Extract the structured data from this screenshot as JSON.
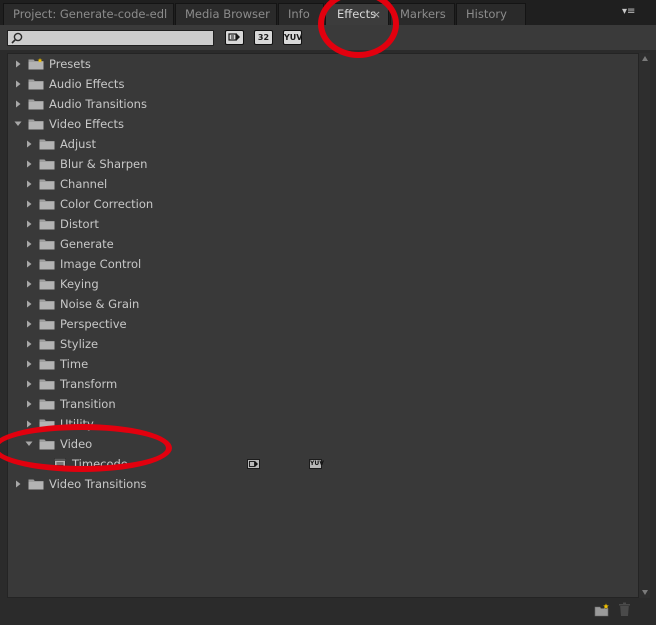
{
  "tabs": [
    {
      "label": "Project: Generate-code-edl",
      "active": false
    },
    {
      "label": "Media Browser",
      "active": false
    },
    {
      "label": "Info",
      "active": false
    },
    {
      "label": "Effects",
      "active": true,
      "close": "×"
    },
    {
      "label": "Markers",
      "active": false
    },
    {
      "label": "History",
      "active": false
    }
  ],
  "panel_menu_glyph": "▾≡",
  "search": {
    "value": "",
    "placeholder": ""
  },
  "toolbar": {
    "accelerated_label": "",
    "bit32_label": "32",
    "yuv_label": "YUV"
  },
  "tree": [
    {
      "label": "Presets",
      "level": 0,
      "expanded": false,
      "icon": "preset-folder-icon"
    },
    {
      "label": "Audio Effects",
      "level": 0,
      "expanded": false,
      "icon": "folder-icon"
    },
    {
      "label": "Audio Transitions",
      "level": 0,
      "expanded": false,
      "icon": "folder-icon"
    },
    {
      "label": "Video Effects",
      "level": 0,
      "expanded": true,
      "icon": "folder-icon"
    },
    {
      "label": "Adjust",
      "level": 1,
      "expanded": false,
      "icon": "folder-icon"
    },
    {
      "label": "Blur & Sharpen",
      "level": 1,
      "expanded": false,
      "icon": "folder-icon"
    },
    {
      "label": "Channel",
      "level": 1,
      "expanded": false,
      "icon": "folder-icon"
    },
    {
      "label": "Color Correction",
      "level": 1,
      "expanded": false,
      "icon": "folder-icon"
    },
    {
      "label": "Distort",
      "level": 1,
      "expanded": false,
      "icon": "folder-icon"
    },
    {
      "label": "Generate",
      "level": 1,
      "expanded": false,
      "icon": "folder-icon"
    },
    {
      "label": "Image Control",
      "level": 1,
      "expanded": false,
      "icon": "folder-icon"
    },
    {
      "label": "Keying",
      "level": 1,
      "expanded": false,
      "icon": "folder-icon"
    },
    {
      "label": "Noise & Grain",
      "level": 1,
      "expanded": false,
      "icon": "folder-icon"
    },
    {
      "label": "Perspective",
      "level": 1,
      "expanded": false,
      "icon": "folder-icon"
    },
    {
      "label": "Stylize",
      "level": 1,
      "expanded": false,
      "icon": "folder-icon"
    },
    {
      "label": "Time",
      "level": 1,
      "expanded": false,
      "icon": "folder-icon"
    },
    {
      "label": "Transform",
      "level": 1,
      "expanded": false,
      "icon": "folder-icon"
    },
    {
      "label": "Transition",
      "level": 1,
      "expanded": false,
      "icon": "folder-icon"
    },
    {
      "label": "Utility",
      "level": 1,
      "expanded": false,
      "icon": "folder-icon"
    },
    {
      "label": "Video",
      "level": 1,
      "expanded": true,
      "icon": "folder-icon"
    },
    {
      "label": "Timecode",
      "level": 2,
      "effect": true,
      "icon": "effect-icon",
      "badges": [
        "accelerated-badge-icon",
        "yuv-badge-icon"
      ]
    },
    {
      "label": "Video Transitions",
      "level": 0,
      "expanded": false,
      "icon": "folder-icon"
    }
  ],
  "colors": {
    "annotation": "#e2000e",
    "panel": "#2b2b2b",
    "list": "#393939",
    "text": "#c8c8c8"
  }
}
